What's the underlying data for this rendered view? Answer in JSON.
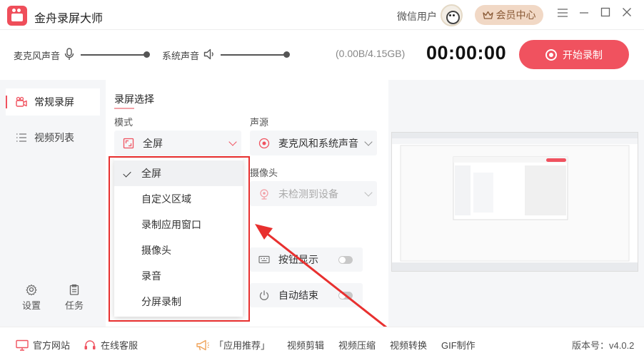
{
  "app": {
    "title": "金舟录屏大师",
    "user_name": "微信用户",
    "vip_label": "会员中心"
  },
  "audio": {
    "mic_label": "麦克风声音",
    "system_label": "系统声音",
    "mic_level": 1.0,
    "system_level": 1.0
  },
  "storage": "(0.00B/4.15GB)",
  "timer": "00:00:00",
  "record_button": "开始录制",
  "sidebar": {
    "items": [
      {
        "label": "常规录屏",
        "icon": "camera-icon",
        "active": true
      },
      {
        "label": "视频列表",
        "icon": "list-icon",
        "active": false
      }
    ],
    "settings_label": "设置",
    "tasks_label": "任务"
  },
  "panel": {
    "section_title": "录屏选择",
    "mode_label": "模式",
    "mode_value": "全屏",
    "audio_source_label": "声源",
    "audio_source_value": "麦克风和系统声音",
    "camera_label": "摄像头",
    "camera_value": "未检测到设备",
    "button_show_label": "按钮显示",
    "auto_end_label": "自动结束"
  },
  "dropdown": {
    "options": [
      "全屏",
      "自定义区域",
      "录制应用窗口",
      "摄像头",
      "录音",
      "分屏录制"
    ],
    "selected": "全屏"
  },
  "footer": {
    "website": "官方网站",
    "support": "在线客服",
    "recommend": "「应用推荐」",
    "video_edit": "视频剪辑",
    "video_compress": "视频压缩",
    "video_convert": "视频转换",
    "gif": "GIF制作",
    "version": "版本号：v4.0.2"
  },
  "colors": {
    "accent": "#f0525f",
    "vip_bg": "#f1d8c5",
    "annotation_red": "#e8302f"
  }
}
